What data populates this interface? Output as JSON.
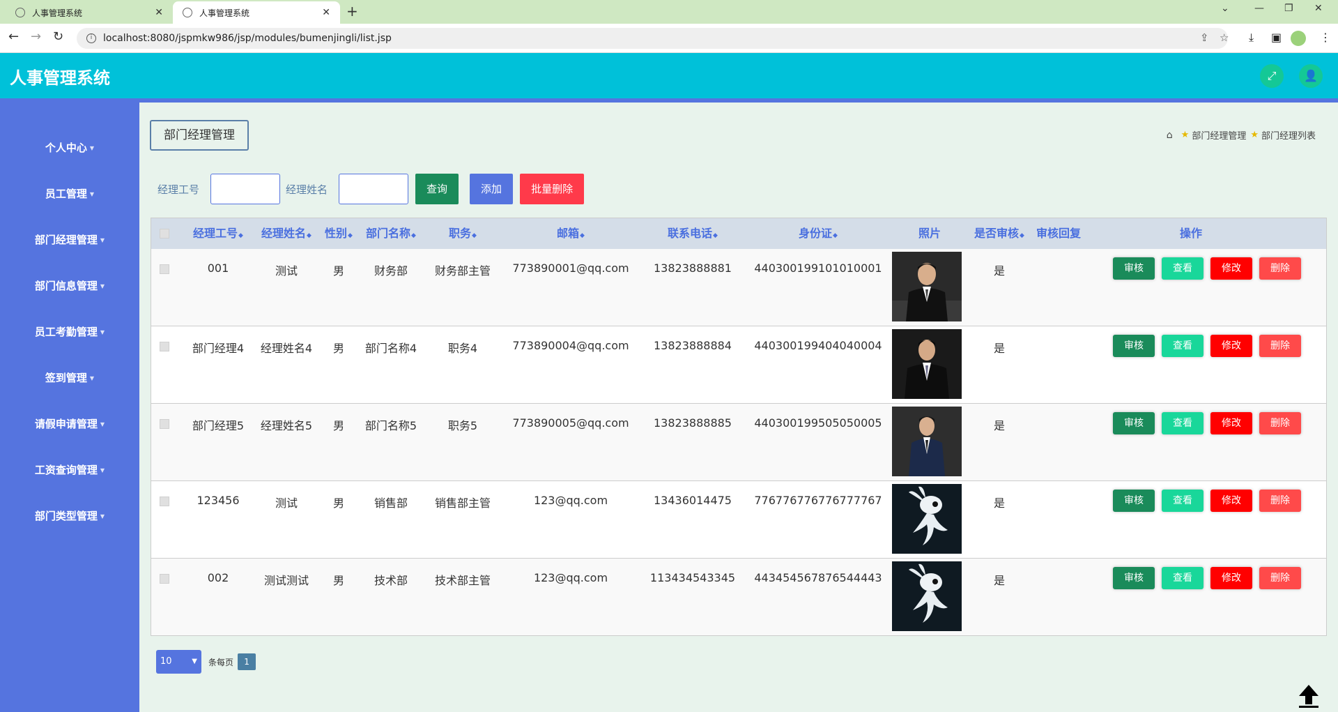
{
  "browser": {
    "tabs": [
      {
        "title": "人事管理系统",
        "active": false
      },
      {
        "title": "人事管理系统",
        "active": true
      }
    ],
    "url": "localhost:8080/jspmkw986/jsp/modules/bumenjingli/list.jsp"
  },
  "app": {
    "title": "人事管理系统"
  },
  "sidebar": {
    "items": [
      {
        "label": "个人中心"
      },
      {
        "label": "员工管理"
      },
      {
        "label": "部门经理管理"
      },
      {
        "label": "部门信息管理"
      },
      {
        "label": "员工考勤管理"
      },
      {
        "label": "签到管理"
      },
      {
        "label": "请假申请管理"
      },
      {
        "label": "工资查询管理"
      },
      {
        "label": "部门类型管理"
      }
    ]
  },
  "page": {
    "title": "部门经理管理",
    "breadcrumb": [
      "部门经理管理",
      "部门经理列表"
    ]
  },
  "search": {
    "label_id": "经理工号",
    "label_name": "经理姓名",
    "query": "查询",
    "add": "添加",
    "bulk_delete": "批量删除"
  },
  "table": {
    "headers": {
      "id": "经理工号",
      "name": "经理姓名",
      "gender": "性别",
      "dept": "部门名称",
      "position": "职务",
      "email": "邮箱",
      "phone": "联系电话",
      "idcard": "身份证",
      "photo": "照片",
      "approved": "是否审核",
      "reply": "审核回复",
      "actions": "操作"
    },
    "actions": {
      "review": "审核",
      "view": "查看",
      "edit": "修改",
      "delete": "删除"
    },
    "rows": [
      {
        "id": "001",
        "name": "测试",
        "gender": "男",
        "dept": "财务部",
        "position": "财务部主管",
        "email": "773890001@qq.com",
        "phone": "13823888881",
        "idcard": "440300199101010001",
        "approved": "是",
        "photo": "man-suit"
      },
      {
        "id": "部门经理4",
        "name": "经理姓名4",
        "gender": "男",
        "dept": "部门名称4",
        "position": "职务4",
        "email": "773890004@qq.com",
        "phone": "13823888884",
        "idcard": "440300199404040004",
        "approved": "是",
        "photo": "man-suit"
      },
      {
        "id": "部门经理5",
        "name": "经理姓名5",
        "gender": "男",
        "dept": "部门名称5",
        "position": "职务5",
        "email": "773890005@qq.com",
        "phone": "13823888885",
        "idcard": "440300199505050005",
        "approved": "是",
        "photo": "man-suit"
      },
      {
        "id": "123456",
        "name": "测试",
        "gender": "男",
        "dept": "销售部",
        "position": "销售部主管",
        "email": "123@qq.com",
        "phone": "13436014475",
        "idcard": "776776776776777767",
        "approved": "是",
        "photo": "rabbit"
      },
      {
        "id": "002",
        "name": "测试测试",
        "gender": "男",
        "dept": "技术部",
        "position": "技术部主管",
        "email": "123@qq.com",
        "phone": "113434543345",
        "idcard": "443454567876544443",
        "approved": "是",
        "photo": "rabbit"
      }
    ]
  },
  "pager": {
    "page_size": "10",
    "per_page_label": "条每页",
    "current_page": "1"
  },
  "colors": {
    "header": "#00c1d9",
    "sidebar": "#5574df",
    "accent_green": "#1a8b5a",
    "danger": "#ff3a4a"
  }
}
